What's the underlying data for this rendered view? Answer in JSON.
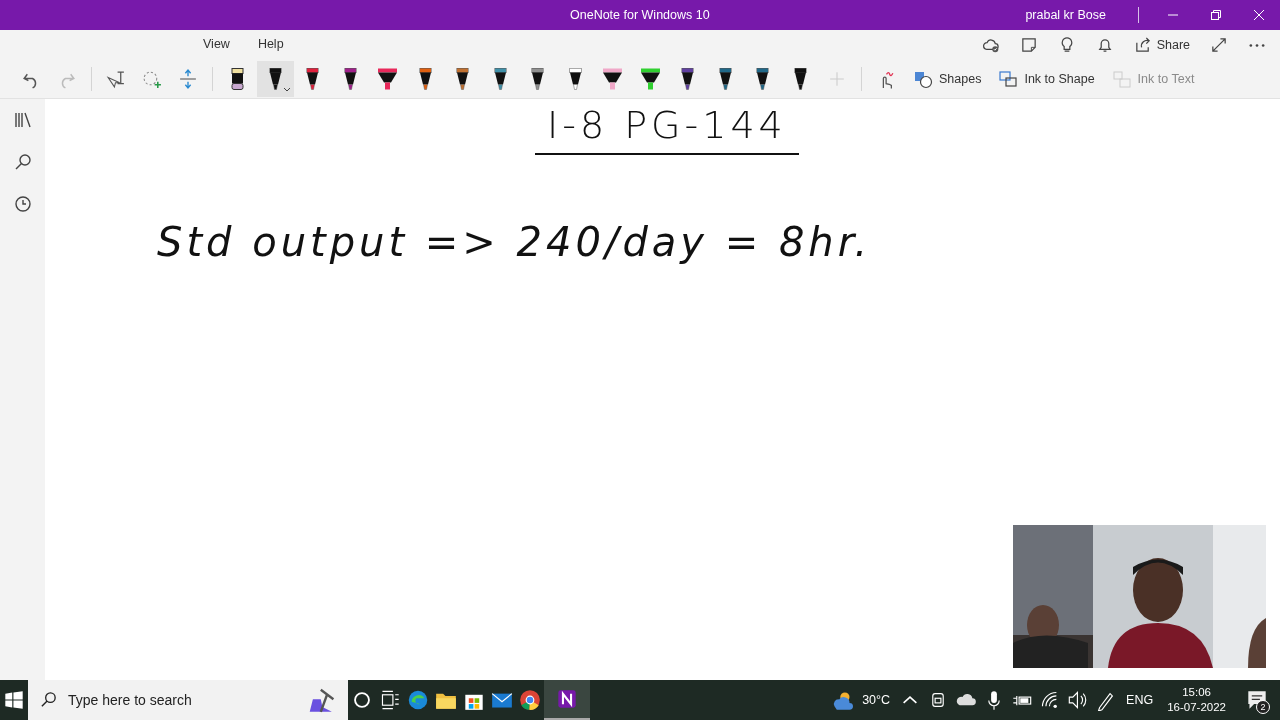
{
  "window": {
    "title": "OneNote for Windows 10",
    "user": "prabal kr Bose"
  },
  "ribbon_tabs": [
    {
      "label": "View",
      "selected": false
    },
    {
      "label": "Help",
      "selected": false
    }
  ],
  "ribbon_actions": [
    {
      "kind": "sync"
    },
    {
      "kind": "note"
    },
    {
      "kind": "bulb"
    },
    {
      "kind": "bell"
    },
    {
      "kind": "share",
      "label": "Share"
    },
    {
      "kind": "expand"
    },
    {
      "kind": "more"
    }
  ],
  "pens": [
    {
      "kind": "eraser",
      "color": "#c8a8d0",
      "selected": false
    },
    {
      "kind": "pen",
      "color": "#101010",
      "selected": true
    },
    {
      "kind": "pen",
      "color": "#e0203c",
      "selected": false
    },
    {
      "kind": "pen",
      "color": "#a0208a",
      "selected": false
    },
    {
      "kind": "highlighter",
      "color": "#e8285a",
      "selected": false
    },
    {
      "kind": "pen",
      "color": "#e06010",
      "selected": false
    },
    {
      "kind": "pen",
      "color": "#c07030",
      "selected": false
    },
    {
      "kind": "pen",
      "color": "#4090a8",
      "selected": false
    },
    {
      "kind": "pen",
      "color": "#909090",
      "selected": false
    },
    {
      "kind": "pen",
      "color": "#ffffff",
      "selected": false
    },
    {
      "kind": "highlighter",
      "color": "#f0a8c8",
      "selected": false
    },
    {
      "kind": "highlighter",
      "color": "#30d030",
      "selected": false
    },
    {
      "kind": "pen",
      "color": "#6040a0",
      "selected": false
    },
    {
      "kind": "pen",
      "color": "#206888",
      "selected": false
    },
    {
      "kind": "pen",
      "color": "#206888",
      "selected": false
    },
    {
      "kind": "pen",
      "color": "#101010",
      "selected": false
    }
  ],
  "draw_tools": [
    {
      "kind": "shapes",
      "label": "Shapes",
      "disabled": false
    },
    {
      "kind": "ink_to_shape",
      "label": "Ink to Shape",
      "disabled": false
    },
    {
      "kind": "ink_to_text",
      "label": "Ink to Text",
      "disabled": true
    }
  ],
  "ink": [
    {
      "text": "I-8 PG-144",
      "underline": true
    },
    {
      "text": "Std output => 240/day = 8hr.",
      "underline": false
    }
  ],
  "taskbar": {
    "search_placeholder": "Type here to search",
    "weather": "30°C",
    "language": "ENG",
    "time": "15:06",
    "date": "16-07-2022",
    "notifications": "2"
  }
}
